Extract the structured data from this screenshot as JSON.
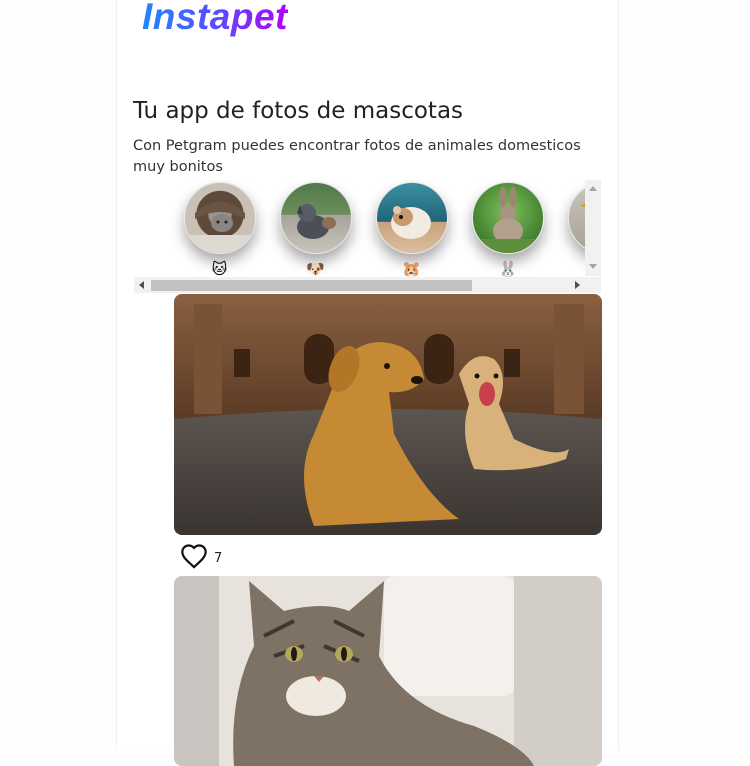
{
  "app": {
    "logo": "Instapet",
    "title": "Tu app de fotos de mascotas",
    "subtitle": "Con Petgram puedes encontrar fotos de animales domesticos muy bonitos"
  },
  "categories": [
    {
      "name": "cat",
      "emoji": "🐱"
    },
    {
      "name": "dog",
      "emoji": "🐶"
    },
    {
      "name": "hamster",
      "emoji": "🐹"
    },
    {
      "name": "rabbit",
      "emoji": "🐰"
    },
    {
      "name": "bird",
      "emoji": "🐦"
    }
  ],
  "posts": [
    {
      "subject": "two dogs lying in front of a cathedral",
      "likes": "7"
    },
    {
      "subject": "tabby cat on a sofa"
    }
  ],
  "icons": {
    "like": "heart-outline-icon"
  }
}
